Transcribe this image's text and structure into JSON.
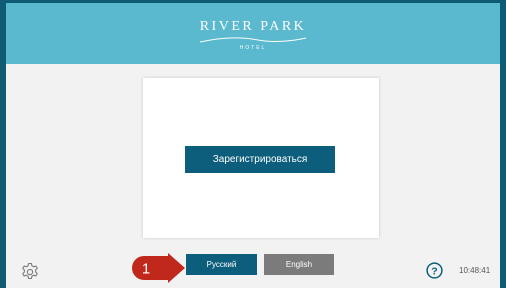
{
  "header": {
    "logo_title": "RIVER PARK",
    "logo_subtitle": "HOTEL",
    "background_color": "#5ab8cf"
  },
  "main": {
    "register_button_label": "Зарегистрироваться"
  },
  "footer": {
    "settings_icon": "gear-icon",
    "languages": [
      {
        "label": "Русский",
        "active": true
      },
      {
        "label": "English",
        "active": false
      }
    ],
    "step_marker_number": "1",
    "help_icon": "help-icon",
    "clock": "10:48:41"
  },
  "colors": {
    "primary": "#0d5e7c",
    "inactive_button": "#7b7b7b",
    "marker": "#c0281c"
  }
}
